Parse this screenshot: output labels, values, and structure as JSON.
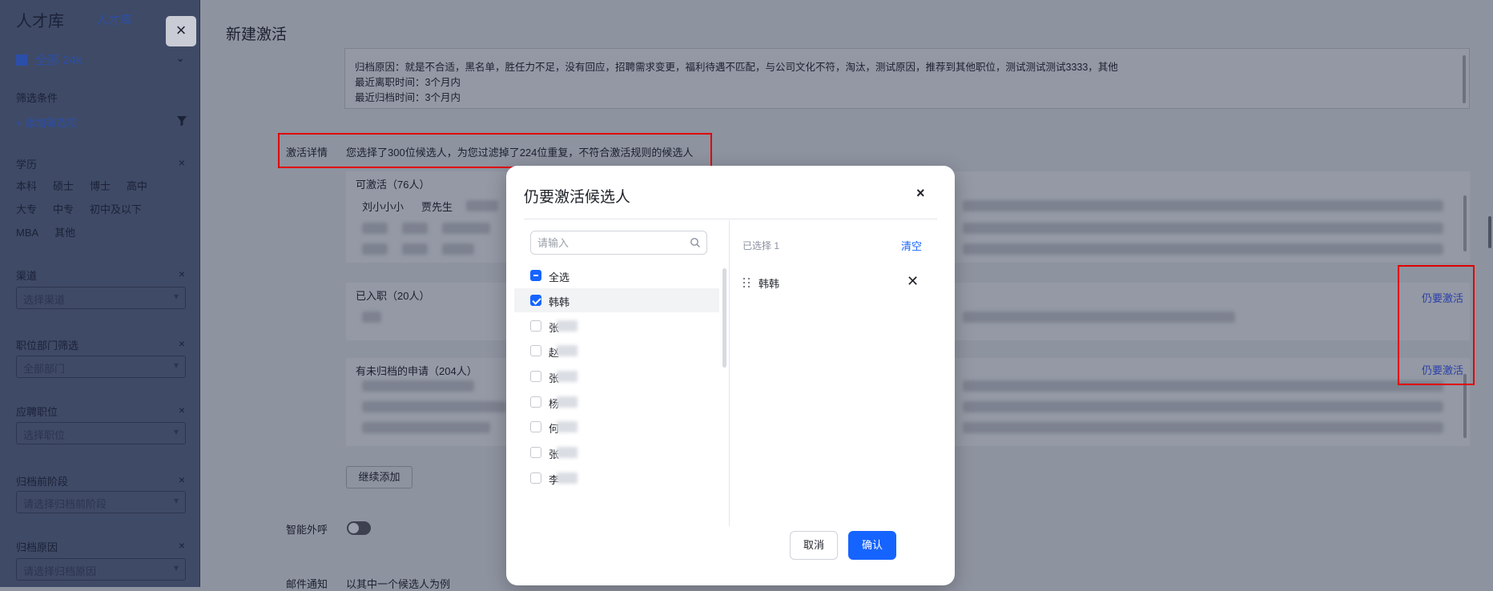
{
  "sidebar": {
    "title": "人才库",
    "tab": "人才库",
    "scope": "全部 24k",
    "filter_heading": "筛选条件",
    "add_filter": "+ 添加筛选项",
    "education": {
      "label": "学历",
      "options": [
        "本科",
        "硕士",
        "博士",
        "高中",
        "大专",
        "中专",
        "初中及以下",
        "MBA",
        "其他"
      ]
    },
    "channel": {
      "label": "渠道",
      "placeholder": "选择渠道"
    },
    "department": {
      "label": "职位部门筛选",
      "placeholder": "全部部门"
    },
    "position": {
      "label": "应聘职位",
      "placeholder": "选择职位"
    },
    "archive_stage": {
      "label": "归档前阶段",
      "placeholder": "请选择归档前阶段"
    },
    "archive_reason": {
      "label": "归档原因",
      "placeholder": "请选择归档原因"
    }
  },
  "main": {
    "close_label": "×",
    "title": "新建激活",
    "reason_lines": [
      "归档原因：就是不合适，黑名单，胜任力不足，没有回应，招聘需求变更，福利待遇不匹配，与公司文化不符，淘汰，测试原因，推荐到其他职位，测试测试测试3333，其他",
      "最近离职时间：3个月内",
      "最近归档时间：3个月内"
    ],
    "detail_label": "激活详情",
    "detail_text": "您选择了300位候选人，为您过滤掉了224位重复，不符合激活规则的候选人",
    "sections": [
      {
        "header": "可激活（76人）",
        "names": [
          "刘小小小",
          "贾先生"
        ]
      },
      {
        "header": "已入职（20人）",
        "action": "仍要激活"
      },
      {
        "header": "有未归档的申请（204人）",
        "action": "仍要激活"
      }
    ],
    "continue_add": "继续添加",
    "smart_call_label": "智能外呼",
    "email_label": "邮件通知",
    "email_hint": "以其中一个候选人为例"
  },
  "modal": {
    "title": "仍要激活候选人",
    "close_label": "×",
    "search": {
      "placeholder": "请输入",
      "value": ""
    },
    "select_all": "全选",
    "candidates": [
      {
        "name": "韩韩",
        "checked": true
      },
      {
        "name": "张",
        "checked": false
      },
      {
        "name": "赵",
        "checked": false
      },
      {
        "name": "张",
        "checked": false
      },
      {
        "name": "杨",
        "checked": false
      },
      {
        "name": "何",
        "checked": false
      },
      {
        "name": "张",
        "checked": false
      },
      {
        "name": "李",
        "checked": false
      }
    ],
    "selected_count": "已选择 1",
    "clear": "清空",
    "selected": [
      {
        "name": "韩韩"
      }
    ],
    "cancel": "取消",
    "confirm": "确认"
  },
  "colors": {
    "primary": "#1664ff",
    "annotation": "#e00000",
    "overlay": "#8f94a1"
  }
}
